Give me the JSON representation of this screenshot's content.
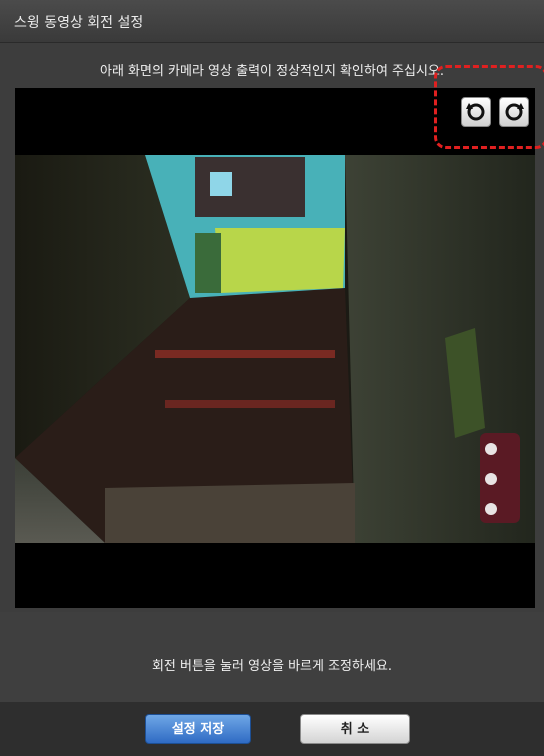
{
  "dialog": {
    "title": "스윙 동영상 회전 설정",
    "instruction": "아래 화면의 카메라 영상 출력이 정상적인지 확인하여 주십시오.",
    "hint": "회전 버튼을 눌러 영상을 바르게 조정하세요.",
    "rotate_left_icon": "rotate-counterclockwise-icon",
    "rotate_right_icon": "rotate-clockwise-icon"
  },
  "buttons": {
    "save_label": "설정 저장",
    "cancel_label": "취 소"
  },
  "colors": {
    "highlight": "#e02020",
    "save_button": "#2f6bc4"
  }
}
